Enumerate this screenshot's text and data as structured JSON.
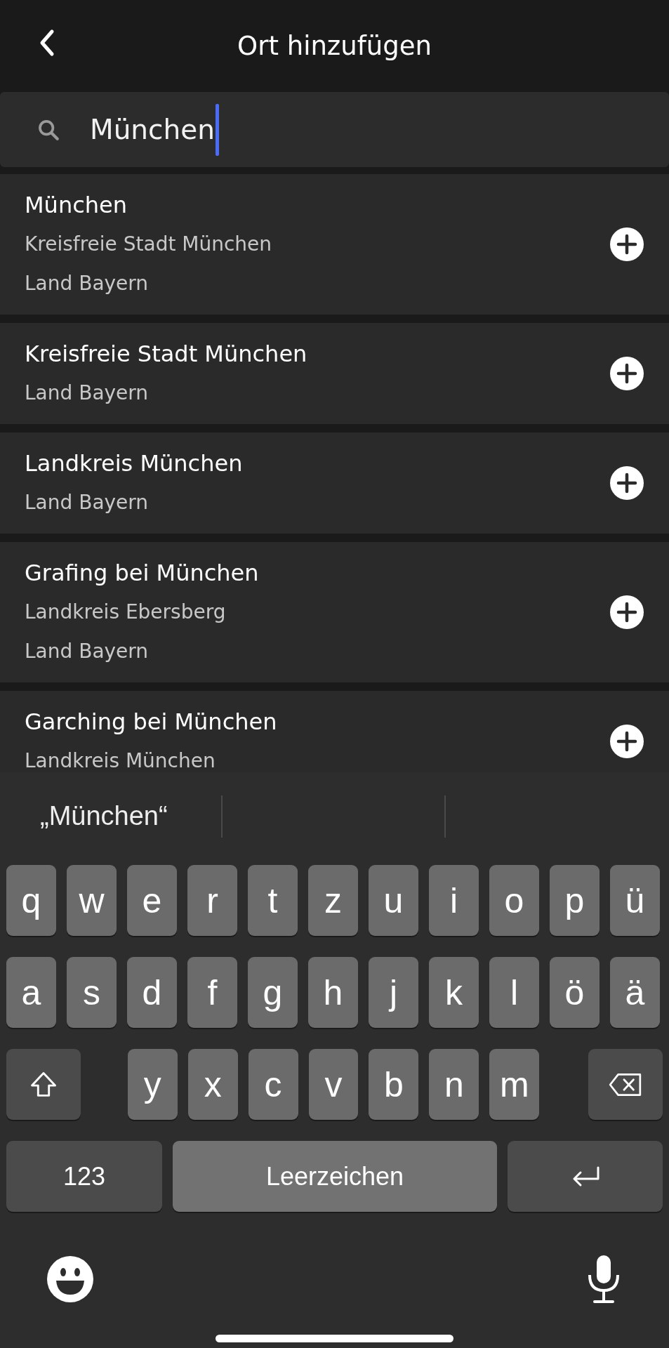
{
  "header": {
    "title": "Ort hinzufügen"
  },
  "search": {
    "value": "München"
  },
  "results": [
    {
      "title": "München",
      "lines": [
        "Kreisfreie Stadt München",
        "Land Bayern"
      ]
    },
    {
      "title": "Kreisfreie Stadt München",
      "lines": [
        "Land Bayern"
      ]
    },
    {
      "title": "Landkreis München",
      "lines": [
        "Land Bayern"
      ]
    },
    {
      "title": "Grafing bei München",
      "lines": [
        "Landkreis Ebersberg",
        "Land Bayern"
      ]
    },
    {
      "title": "Garching bei München",
      "lines": [
        "Landkreis München"
      ]
    }
  ],
  "keyboard": {
    "suggestions": [
      "„München“"
    ],
    "rows": [
      {
        "keys": [
          {
            "kind": "letter",
            "label": "q"
          },
          {
            "kind": "letter",
            "label": "w"
          },
          {
            "kind": "letter",
            "label": "e"
          },
          {
            "kind": "letter",
            "label": "r"
          },
          {
            "kind": "letter",
            "label": "t"
          },
          {
            "kind": "letter",
            "label": "z"
          },
          {
            "kind": "letter",
            "label": "u"
          },
          {
            "kind": "letter",
            "label": "i"
          },
          {
            "kind": "letter",
            "label": "o"
          },
          {
            "kind": "letter",
            "label": "p"
          },
          {
            "kind": "letter",
            "label": "ü"
          }
        ]
      },
      {
        "keys": [
          {
            "kind": "letter",
            "label": "a"
          },
          {
            "kind": "letter",
            "label": "s"
          },
          {
            "kind": "letter",
            "label": "d"
          },
          {
            "kind": "letter",
            "label": "f"
          },
          {
            "kind": "letter",
            "label": "g"
          },
          {
            "kind": "letter",
            "label": "h"
          },
          {
            "kind": "letter",
            "label": "j"
          },
          {
            "kind": "letter",
            "label": "k"
          },
          {
            "kind": "letter",
            "label": "l"
          },
          {
            "kind": "letter",
            "label": "ö"
          },
          {
            "kind": "letter",
            "label": "ä"
          }
        ]
      },
      {
        "keys": [
          {
            "kind": "shift"
          },
          {
            "kind": "letter",
            "label": "y"
          },
          {
            "kind": "letter",
            "label": "x"
          },
          {
            "kind": "letter",
            "label": "c"
          },
          {
            "kind": "letter",
            "label": "v"
          },
          {
            "kind": "letter",
            "label": "b"
          },
          {
            "kind": "letter",
            "label": "n"
          },
          {
            "kind": "letter",
            "label": "m"
          },
          {
            "kind": "delete"
          }
        ]
      },
      {
        "keys": [
          {
            "kind": "mode",
            "label": "123"
          },
          {
            "kind": "space",
            "label": "Leerzeichen"
          },
          {
            "kind": "return"
          }
        ]
      }
    ]
  }
}
